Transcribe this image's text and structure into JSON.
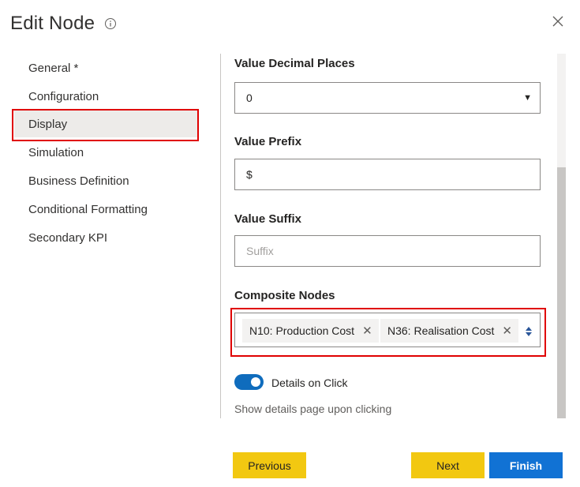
{
  "dialog": {
    "title": "Edit Node",
    "info_icon": "info-circle-icon",
    "close_icon": "close-icon"
  },
  "sidebar": {
    "items": [
      {
        "label": "General *"
      },
      {
        "label": "Configuration"
      },
      {
        "label": "Display",
        "selected": true
      },
      {
        "label": "Simulation"
      },
      {
        "label": "Business Definition"
      },
      {
        "label": "Conditional Formatting"
      },
      {
        "label": "Secondary KPI"
      }
    ]
  },
  "fields": {
    "decimal_places": {
      "label": "Value Decimal Places",
      "value": "0"
    },
    "prefix": {
      "label": "Value Prefix",
      "value": "$"
    },
    "suffix": {
      "label": "Value Suffix",
      "value": "",
      "placeholder": "Suffix"
    },
    "composite_nodes": {
      "label": "Composite Nodes",
      "tags": [
        "N10: Production Cost",
        "N36: Realisation Cost"
      ]
    }
  },
  "toggle": {
    "label": "Details on Click",
    "on": true,
    "help_text": "Show details page upon clicking"
  },
  "buttons": {
    "previous": "Previous",
    "next": "Next",
    "finish": "Finish"
  },
  "colors": {
    "highlight": "#e00000",
    "accent_yellow": "#f2c811",
    "accent_blue": "#1172d4",
    "toggle_on": "#0f6cbd"
  }
}
